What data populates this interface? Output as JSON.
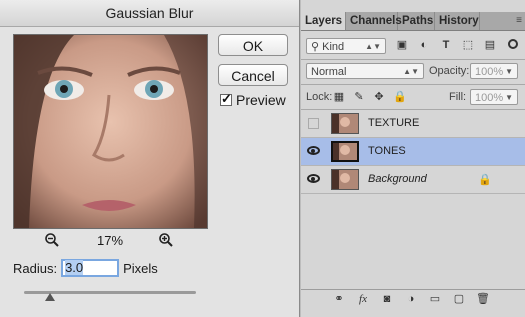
{
  "dialog": {
    "title": "Gaussian Blur",
    "ok_label": "OK",
    "cancel_label": "Cancel",
    "preview_label": "Preview",
    "preview_checked": true,
    "zoom_percent": "17%",
    "radius_label": "Radius:",
    "radius_value": "3.0",
    "radius_unit": "Pixels",
    "slider_level": 0.15
  },
  "panel": {
    "tabs": [
      "Layers",
      "Channels",
      "Paths",
      "History"
    ],
    "active_tab": "Layers",
    "filter_kind": "Kind",
    "blend_mode": "Normal",
    "opacity_label": "Opacity:",
    "opacity_value": "100%",
    "lock_label": "Lock:",
    "fill_label": "Fill:",
    "fill_value": "100%",
    "layers": [
      {
        "name": "TEXTURE",
        "visible": false,
        "selected": false,
        "italic": false,
        "locked": false
      },
      {
        "name": "TONES",
        "visible": true,
        "selected": true,
        "italic": false,
        "locked": false
      },
      {
        "name": "Background",
        "visible": true,
        "selected": false,
        "italic": true,
        "locked": true
      }
    ]
  },
  "colors": {
    "selection": "#a7bde8",
    "input_focus": "#7aa7e0"
  }
}
